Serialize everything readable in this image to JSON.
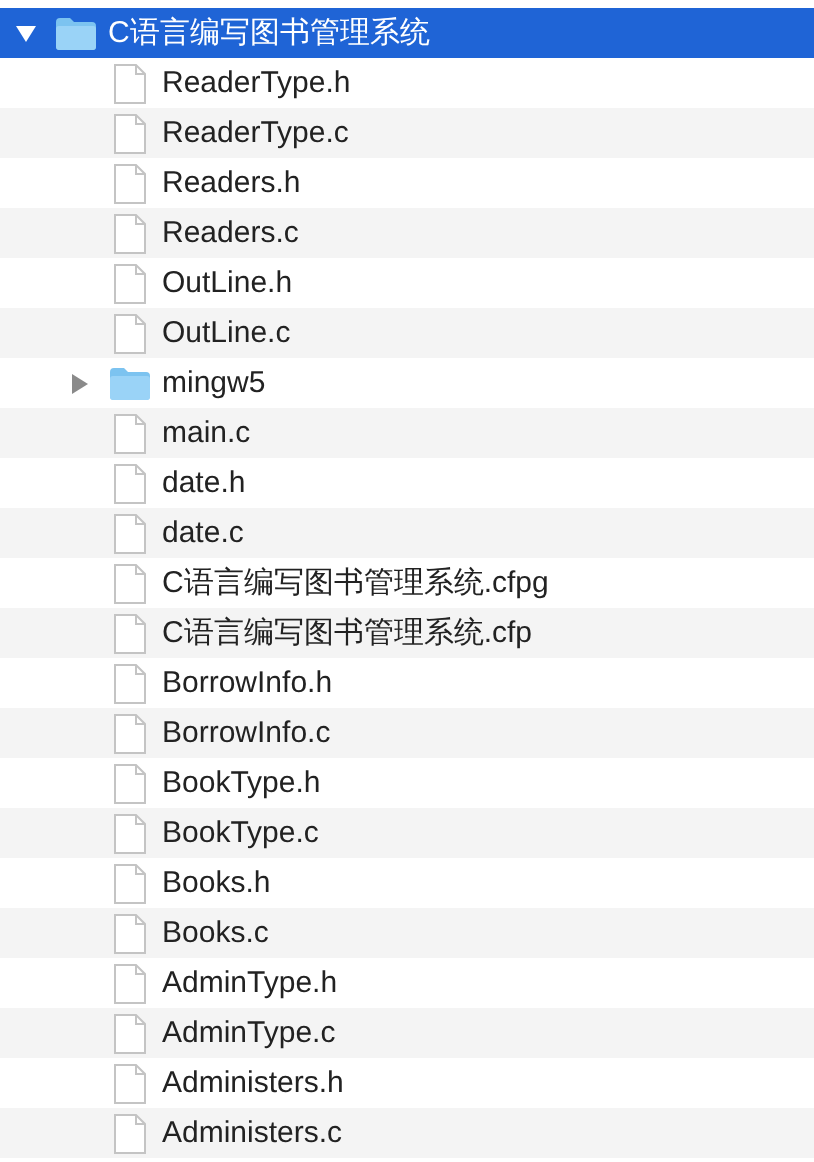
{
  "tree": [
    {
      "name": "C语言编写图书管理系统",
      "kind": "folder",
      "expanded": true,
      "selected": true,
      "children": [
        {
          "name": "ReaderType.h",
          "kind": "file",
          "selected": false
        },
        {
          "name": "ReaderType.c",
          "kind": "file",
          "selected": false
        },
        {
          "name": "Readers.h",
          "kind": "file",
          "selected": false
        },
        {
          "name": "Readers.c",
          "kind": "file",
          "selected": false
        },
        {
          "name": "OutLine.h",
          "kind": "file",
          "selected": false
        },
        {
          "name": "OutLine.c",
          "kind": "file",
          "selected": false
        },
        {
          "name": "mingw5",
          "kind": "folder",
          "expanded": false,
          "selected": false
        },
        {
          "name": "main.c",
          "kind": "file",
          "selected": false
        },
        {
          "name": "date.h",
          "kind": "file",
          "selected": false
        },
        {
          "name": "date.c",
          "kind": "file",
          "selected": false
        },
        {
          "name": "C语言编写图书管理系统.cfpg",
          "kind": "file",
          "selected": false
        },
        {
          "name": "C语言编写图书管理系统.cfp",
          "kind": "file",
          "selected": false
        },
        {
          "name": "BorrowInfo.h",
          "kind": "file",
          "selected": false
        },
        {
          "name": "BorrowInfo.c",
          "kind": "file",
          "selected": false
        },
        {
          "name": "BookType.h",
          "kind": "file",
          "selected": false
        },
        {
          "name": "BookType.c",
          "kind": "file",
          "selected": false
        },
        {
          "name": "Books.h",
          "kind": "file",
          "selected": false
        },
        {
          "name": "Books.c",
          "kind": "file",
          "selected": false
        },
        {
          "name": "AdminType.h",
          "kind": "file",
          "selected": false
        },
        {
          "name": "AdminType.c",
          "kind": "file",
          "selected": false
        },
        {
          "name": "Administers.h",
          "kind": "file",
          "selected": false
        },
        {
          "name": "Administers.c",
          "kind": "file",
          "selected": false
        }
      ]
    }
  ]
}
